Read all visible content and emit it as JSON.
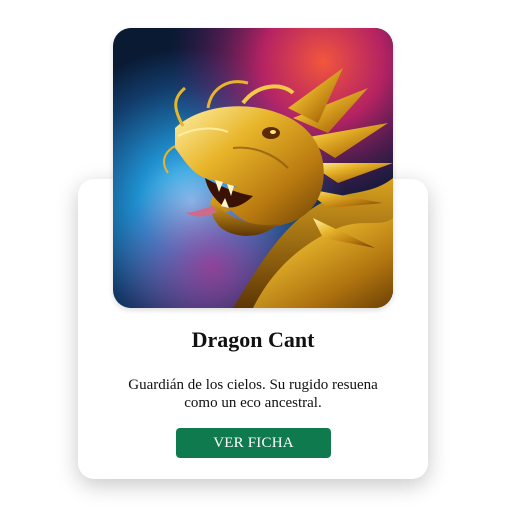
{
  "card": {
    "title": "Dragon Cant",
    "description": "Guardián de los cielos. Su rugido resuena como un eco ancestral.",
    "button_label": "VER FICHA",
    "button_color": "#0f7a4e",
    "image_icon": "dragon-image"
  }
}
